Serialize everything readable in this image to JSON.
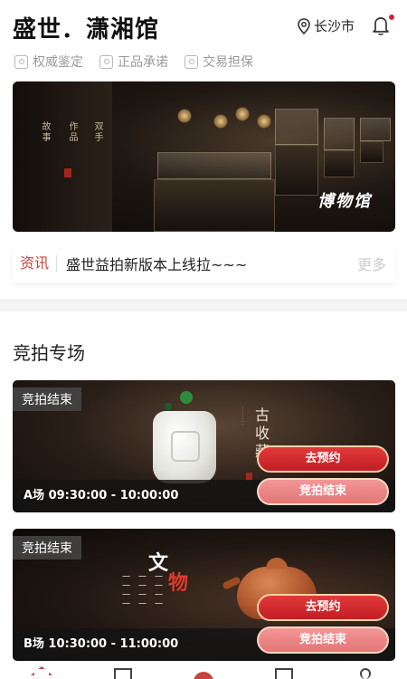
{
  "header": {
    "brand": "盛世．潇湘馆",
    "city": "长沙市",
    "location_icon": "location-pin-icon",
    "bell_icon": "bell-icon",
    "notification_color": "#d0263a"
  },
  "badges": [
    {
      "label": "权威鉴定",
      "icon": "certified-icon"
    },
    {
      "label": "正品承诺",
      "icon": "genuine-icon"
    },
    {
      "label": "交易担保",
      "icon": "guarantee-icon"
    }
  ],
  "banner": {
    "caption": "博物馆",
    "vertical_texts": [
      "故事",
      "作品",
      "双手"
    ]
  },
  "news": {
    "tag": "资讯",
    "text": "盛世益拍新版本上线拉~~~",
    "more": "更多"
  },
  "auctions": {
    "title": "竞拍专场",
    "items": [
      {
        "status": "竞拍结束",
        "time": "A场 09:30:00 - 10:00:00",
        "reserve_label": "去预约",
        "ended_label": "竞拍结束",
        "calligraphy": "古收藏"
      },
      {
        "status": "竞拍结束",
        "time": "B场 10:30:00 - 11:00:00",
        "reserve_label": "去预约",
        "ended_label": "竞拍结束",
        "title_a": "文",
        "title_b": "物"
      }
    ]
  },
  "colors": {
    "accent": "#c8443e",
    "reserve_button": "#d42a2f",
    "ended_button": "#ec8585"
  }
}
